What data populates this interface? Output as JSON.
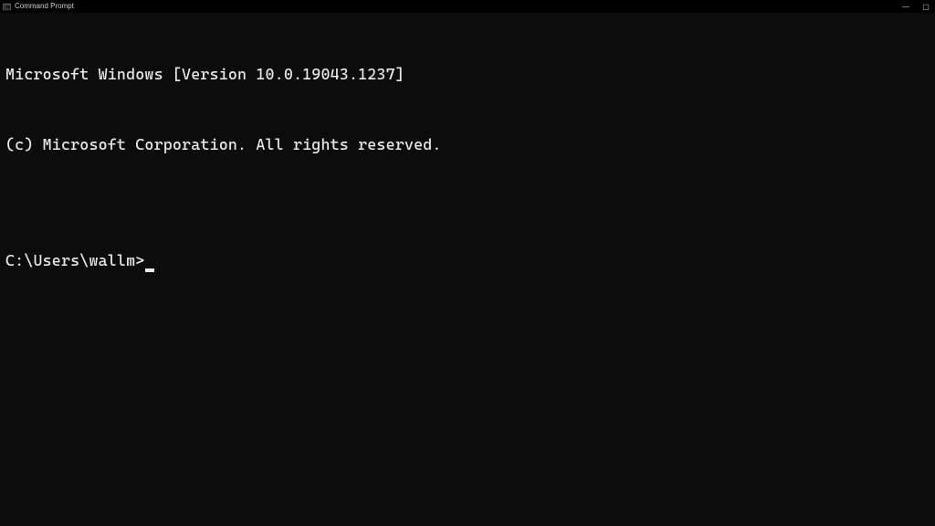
{
  "titlebar": {
    "title": "Command Prompt",
    "controls": {
      "minimize": "—",
      "maximize": "▢"
    }
  },
  "terminal": {
    "line1": "Microsoft Windows [Version 10.0.19043.1237]",
    "line2": "(c) Microsoft Corporation. All rights reserved.",
    "blank": "",
    "prompt": "C:\\Users\\wallm>"
  }
}
